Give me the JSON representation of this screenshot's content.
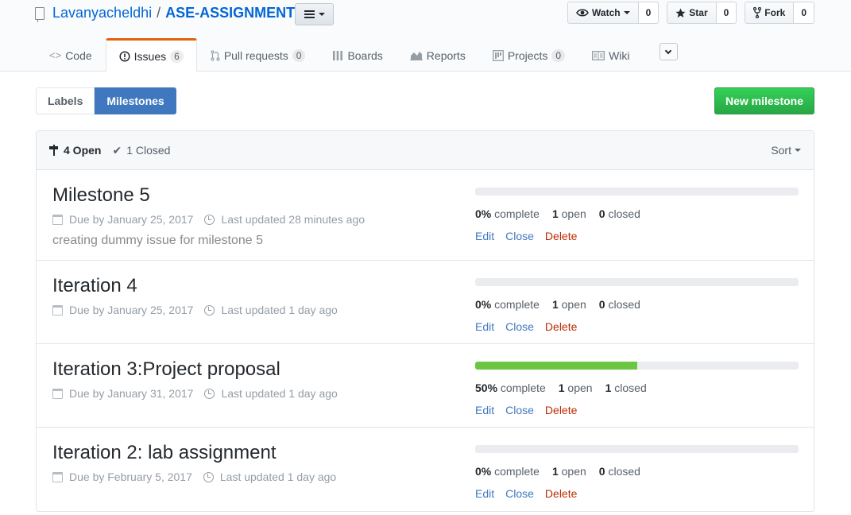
{
  "repo": {
    "owner": "Lavanyacheldhi",
    "separator": "/",
    "name": "ASE-ASSIGNMENTS"
  },
  "actions": [
    {
      "label": "Watch",
      "count": "0",
      "icon": "eye-icon"
    },
    {
      "label": "Star",
      "count": "0",
      "icon": "star-icon"
    },
    {
      "label": "Fork",
      "count": "0",
      "icon": "fork-icon"
    }
  ],
  "tabs": [
    {
      "label": "Code",
      "icon": "code-icon",
      "counter": null
    },
    {
      "label": "Issues",
      "icon": "issue-icon",
      "counter": "6",
      "selected": true
    },
    {
      "label": "Pull requests",
      "icon": "pull-request-icon",
      "counter": "0"
    },
    {
      "label": "Boards",
      "icon": "boards-icon",
      "counter": null
    },
    {
      "label": "Reports",
      "icon": "graph-icon",
      "counter": null
    },
    {
      "label": "Projects",
      "icon": "project-icon",
      "counter": "0"
    },
    {
      "label": "Wiki",
      "icon": "book-icon",
      "counter": null
    }
  ],
  "subnav": {
    "labels": "Labels",
    "milestones": "Milestones"
  },
  "new_milestone": "New milestone",
  "states": {
    "open": "4 Open",
    "closed": "1 Closed",
    "sort": "Sort"
  },
  "colors": {
    "accent": "#4078c0",
    "progress": "#6cc644",
    "danger": "#bd2c00",
    "new_button": "#28a745",
    "tab_highlight": "#e36209"
  },
  "milestones": [
    {
      "title": "Milestone 5",
      "due": "Due by January 25, 2017",
      "updated": "Last updated 28 minutes ago",
      "description": "creating dummy issue for milestone 5",
      "percent": "0%",
      "percent_value": 0,
      "open": "1",
      "closed": "0",
      "edit": "Edit",
      "close": "Close",
      "delete": "Delete"
    },
    {
      "title": "Iteration 4",
      "due": "Due by January 25, 2017",
      "updated": "Last updated 1 day ago",
      "description": "",
      "percent": "0%",
      "percent_value": 0,
      "open": "1",
      "closed": "0",
      "edit": "Edit",
      "close": "Close",
      "delete": "Delete"
    },
    {
      "title": "Iteration 3:Project proposal",
      "due": "Due by January 31, 2017",
      "updated": "Last updated 1 day ago",
      "description": "",
      "percent": "50%",
      "percent_value": 50,
      "open": "1",
      "closed": "1",
      "edit": "Edit",
      "close": "Close",
      "delete": "Delete"
    },
    {
      "title": "Iteration 2: lab assignment",
      "due": "Due by February 5, 2017",
      "updated": "Last updated 1 day ago",
      "description": "",
      "percent": "0%",
      "percent_value": 0,
      "open": "1",
      "closed": "0",
      "edit": "Edit",
      "close": "Close",
      "delete": "Delete"
    }
  ],
  "labels": {
    "complete": "complete",
    "open": "open",
    "closed": "closed"
  }
}
